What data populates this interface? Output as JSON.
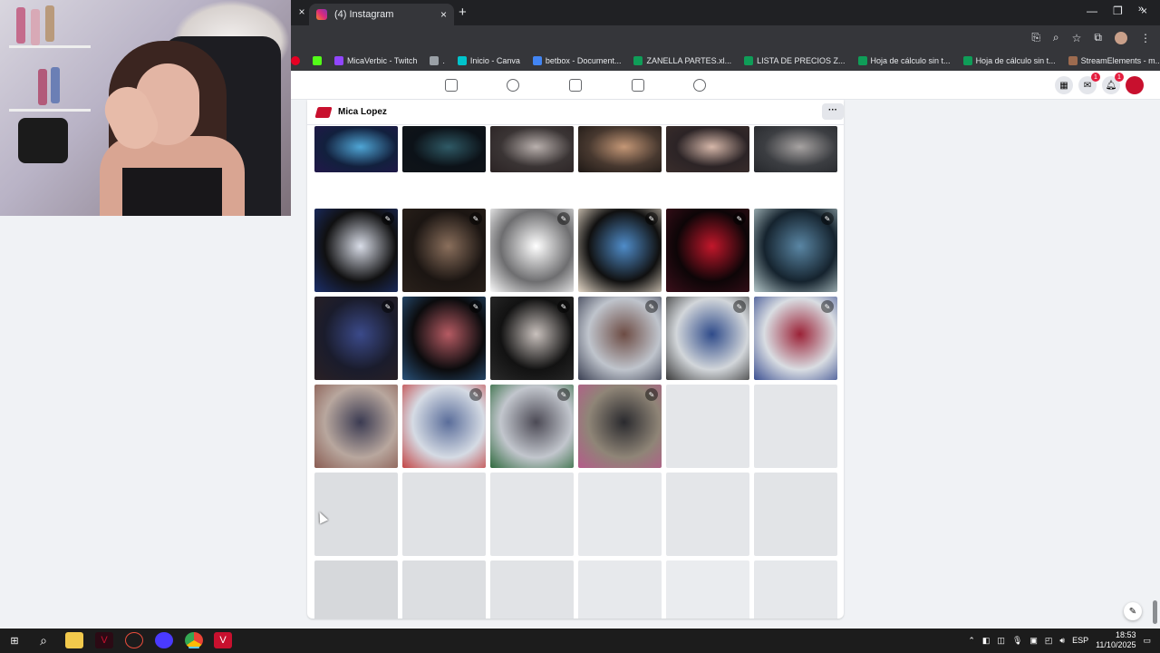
{
  "browser": {
    "tab_title": "(4) Instagram",
    "new_tab_glyph": "+",
    "close_glyph": "×",
    "bookmarks": [
      {
        "label": "MicaVerbic - Twitch",
        "color": "#9146ff"
      },
      {
        "label": ".",
        "color": "#9aa0a6"
      },
      {
        "label": "Inicio - Canva",
        "color": "#00c4cc"
      },
      {
        "label": "betbox - Document...",
        "color": "#4285f4"
      },
      {
        "label": "ZANELLA PARTES.xl...",
        "color": "#0f9d58"
      },
      {
        "label": "LISTA DE PRECIOS Z...",
        "color": "#0f9d58"
      },
      {
        "label": "Hoja de cálculo sin t...",
        "color": "#0f9d58"
      },
      {
        "label": "Hoja de cálculo sin t...",
        "color": "#0f9d58"
      },
      {
        "label": "StreamElements - m...",
        "color": "#9d6b4f"
      }
    ],
    "bookmarks_more": "»"
  },
  "fb": {
    "nav_icons": [
      "home-icon",
      "friends-icon",
      "watch-icon",
      "marketplace-icon",
      "groups-icon"
    ],
    "messenger_badge": "1",
    "notifications_badge": "1"
  },
  "profile": {
    "name": "Mica Lopez",
    "more_label": "···"
  },
  "photos": {
    "rows": [
      [
        {
          "colors": [
            "#12203d",
            "#4fa6d6",
            "#22174a"
          ],
          "edit": false
        },
        {
          "colors": [
            "#0c1218",
            "#2f5a66",
            "#101419"
          ],
          "edit": false
        },
        {
          "colors": [
            "#3a3434",
            "#b9b0ad",
            "#2b2324"
          ],
          "edit": false
        },
        {
          "colors": [
            "#47382f",
            "#c49776",
            "#1e1815"
          ],
          "edit": false
        },
        {
          "colors": [
            "#2c2426",
            "#d6b7a9",
            "#3a2d2b"
          ],
          "edit": false
        },
        {
          "colors": [
            "#3c3e42",
            "#a7a3a2",
            "#26282c"
          ],
          "edit": false
        }
      ],
      [
        {
          "colors": [
            "#101011",
            "#d9dde8",
            "#1c2f6b"
          ],
          "edit": true
        },
        {
          "colors": [
            "#1b1512",
            "#8a6f5c",
            "#2a211b"
          ],
          "edit": true
        },
        {
          "colors": [
            "#6e6e70",
            "#ffffff",
            "#fafafa"
          ],
          "edit": true
        },
        {
          "colors": [
            "#101010",
            "#4f8cc9",
            "#e6d9c8"
          ],
          "edit": true
        },
        {
          "colors": [
            "#0d0507",
            "#c2172b",
            "#3b0f1a"
          ],
          "edit": true
        },
        {
          "colors": [
            "#15232e",
            "#5a86a4",
            "#b4c7c9"
          ],
          "edit": true
        }
      ],
      [
        {
          "colors": [
            "#1a1c2c",
            "#3b4a8a",
            "#2a2024"
          ],
          "edit": true
        },
        {
          "colors": [
            "#0b0b0d",
            "#b65b63",
            "#29527a"
          ],
          "edit": true
        },
        {
          "colors": [
            "#121212",
            "#c9c1bd",
            "#2a2a2a"
          ],
          "edit": true
        },
        {
          "colors": [
            "#bfc4cc",
            "#6d4c44",
            "#3a3f52"
          ],
          "edit": true
        },
        {
          "colors": [
            "#d2d6da",
            "#2f4b8a",
            "#3a3a3a"
          ],
          "edit": true
        },
        {
          "colors": [
            "#d9dde2",
            "#9b2237",
            "#3b4f91"
          ],
          "edit": true
        }
      ],
      [
        {
          "colors": [
            "#b8a79e",
            "#3b3b52",
            "#8a5c52"
          ],
          "edit": false
        },
        {
          "colors": [
            "#d5dbe4",
            "#5a6d9a",
            "#c44545"
          ],
          "edit": true
        },
        {
          "colors": [
            "#c2c6cd",
            "#4c4a55",
            "#2f6a3e"
          ],
          "edit": true
        },
        {
          "colors": [
            "#8f8577",
            "#2a2a2e",
            "#b55b8a"
          ],
          "edit": true
        },
        {
          "placeholder": true,
          "shade": "#e4e6e9"
        },
        {
          "placeholder": true,
          "shade": "#e4e6e9"
        }
      ],
      [
        {
          "placeholder": true,
          "shade": "#dcdee1"
        },
        {
          "placeholder": true,
          "shade": "#e0e2e5"
        },
        {
          "placeholder": true,
          "shade": "#e4e6e9"
        },
        {
          "placeholder": true,
          "shade": "#e7e9ec"
        },
        {
          "placeholder": true,
          "shade": "#e4e6e9"
        },
        {
          "placeholder": true,
          "shade": "#e2e4e7"
        }
      ],
      [
        {
          "placeholder": true,
          "shade": "#d6d8db"
        },
        {
          "placeholder": true,
          "shade": "#dcdee1"
        },
        {
          "placeholder": true,
          "shade": "#e1e3e6"
        },
        {
          "placeholder": true,
          "shade": "#e7e9ec"
        },
        {
          "placeholder": true,
          "shade": "#eaecef"
        },
        {
          "placeholder": true,
          "shade": "#e6e8eb"
        }
      ]
    ],
    "edit_glyph": "✎"
  },
  "taskbar": {
    "search_glyph": "⌕",
    "language": "ESP",
    "time": "18:53",
    "date": "11/10/2025"
  }
}
